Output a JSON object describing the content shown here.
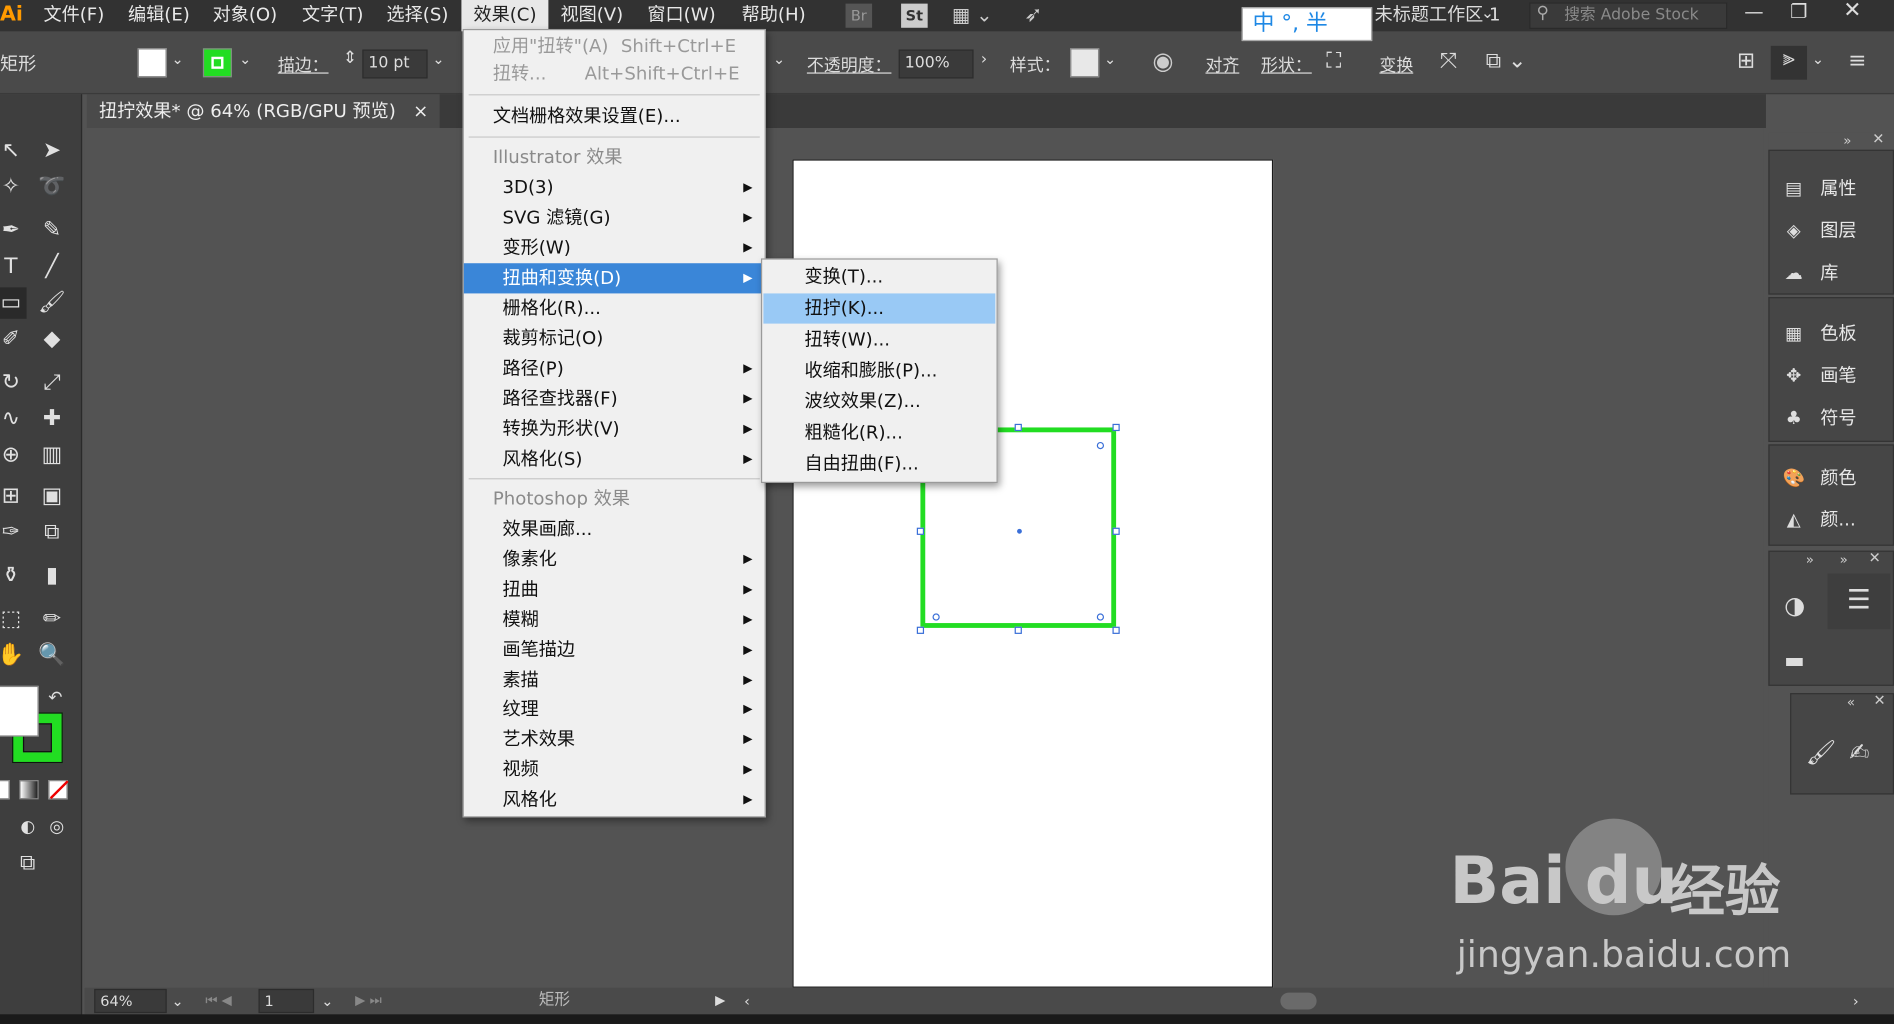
{
  "menubar": {
    "logo": "Ai",
    "items": [
      "文件(F)",
      "编辑(E)",
      "对象(O)",
      "文字(T)",
      "选择(S)",
      "效果(C)",
      "视图(V)",
      "窗口(W)",
      "帮助(H)"
    ],
    "workspace": "未标题工作区 1",
    "ime": "中 °, 半",
    "search_placeholder": "搜索 Adobe Stock"
  },
  "control_bar": {
    "object_type": "矩形",
    "stroke_label": "描边：",
    "stroke_value": "10 pt",
    "opacity_label": "不透明度：",
    "opacity_value": "100%",
    "style_label": "样式：",
    "align_label": "对齐",
    "shape_label": "形状：",
    "transform_label": "变换",
    "fill_color": "#ffffff",
    "stroke_color": "#22dd22"
  },
  "document_tab": {
    "title": "扭拧效果* @ 64% (RGB/GPU 预览)",
    "close": "×"
  },
  "effect_menu": {
    "apply_last": "应用\"扭转\"(A)",
    "apply_last_shortcut": "Shift+Ctrl+E",
    "last_effect": "扭转...",
    "last_effect_shortcut": "Alt+Shift+Ctrl+E",
    "doc_raster": "文档栅格效果设置(E)...",
    "illustrator_header": "Illustrator 效果",
    "illustrator_items": [
      "3D(3)",
      "SVG 滤镜(G)",
      "变形(W)",
      "扭曲和变换(D)",
      "栅格化(R)...",
      "裁剪标记(O)",
      "路径(P)",
      "路径查找器(F)",
      "转换为形状(V)",
      "风格化(S)"
    ],
    "photoshop_header": "Photoshop 效果",
    "photoshop_items": [
      "效果画廊...",
      "像素化",
      "扭曲",
      "模糊",
      "画笔描边",
      "素描",
      "纹理",
      "艺术效果",
      "视频",
      "风格化"
    ]
  },
  "distort_submenu": {
    "items": [
      "变换(T)...",
      "扭拧(K)...",
      "扭转(W)...",
      "收缩和膨胀(P)...",
      "波纹效果(Z)...",
      "粗糙化(R)...",
      "自由扭曲(F)..."
    ]
  },
  "right_panels": {
    "group1": [
      "属性",
      "图层",
      "库"
    ],
    "group2": [
      "色板",
      "画笔",
      "符号"
    ],
    "group3": [
      "颜色",
      "颜..."
    ]
  },
  "status_bar": {
    "zoom": "64%",
    "artboard": "1",
    "tool_name": "矩形"
  },
  "watermark": {
    "brand": "Bai",
    "brand2": "du",
    "cn": "经验",
    "url": "jingyan.baidu.com"
  }
}
